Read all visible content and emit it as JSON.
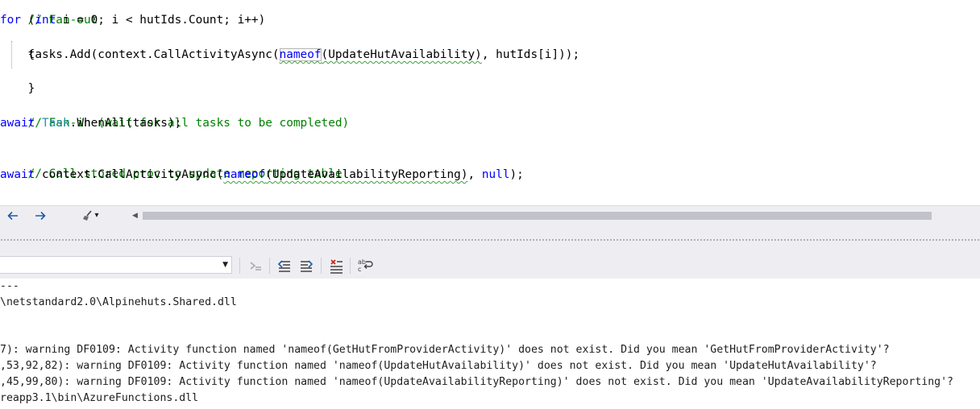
{
  "editor": {
    "lines": {
      "l0_comment": "// Fan-out",
      "l1_for": "for",
      "l1_open": " (",
      "l1_int": "int",
      "l1_rest": " i = 0; i < hutIds.Count; i++)",
      "l2": "{",
      "l3_pre": "    tasks.Add(context.CallActivityAsync(",
      "l3_nameof": "nameof",
      "l3_arg": "(UpdateHutAvailability)",
      "l3_post": ", hutIds[i]));",
      "l4": "}",
      "l6_comment": "// Fan-in (wait for all tasks to be completed)",
      "l7_await": "await",
      "l7_task": "Task",
      "l7_rest": ".WhenAll(tasks);",
      "l9_comment": "// Call stored proc to update reporting table",
      "l10_await": "await",
      "l10_pre": " context.CallActivityAsync(",
      "l10_nameof": "nameof",
      "l10_arg": "(UpdateAvailabilityReporting)",
      "l10_post": ", ",
      "l10_null": "null",
      "l10_end": ");"
    }
  },
  "navbar": {
    "back_glyph": "🡐",
    "forward_glyph": "🡒",
    "tools_glyph": "▾",
    "scroll_left_glyph": "◀"
  },
  "output_pane": {
    "source_value": "",
    "combo_arrow_glyph": "▼",
    "lines": [
      "---",
      "\\netstandard2.0\\Alpinehuts.Shared.dll",
      "",
      "",
      "7): warning DF0109: Activity function named 'nameof(GetHutFromProviderActivity)' does not exist. Did you mean 'GetHutFromProviderActivity'?",
      ",53,92,82): warning DF0109: Activity function named 'nameof(UpdateHutAvailability)' does not exist. Did you mean 'UpdateHutAvailability'?",
      ",45,99,80): warning DF0109: Activity function named 'nameof(UpdateAvailabilityReporting)' does not exist. Did you mean 'UpdateAvailabilityReporting'?",
      "reapp3.1\\bin\\AzureFunctions.dll"
    ]
  },
  "colors": {
    "keyword": "#0000ff",
    "type": "#2b91af",
    "comment": "#008000",
    "squiggle": "#3ea23e",
    "chrome": "#eeeef2"
  }
}
